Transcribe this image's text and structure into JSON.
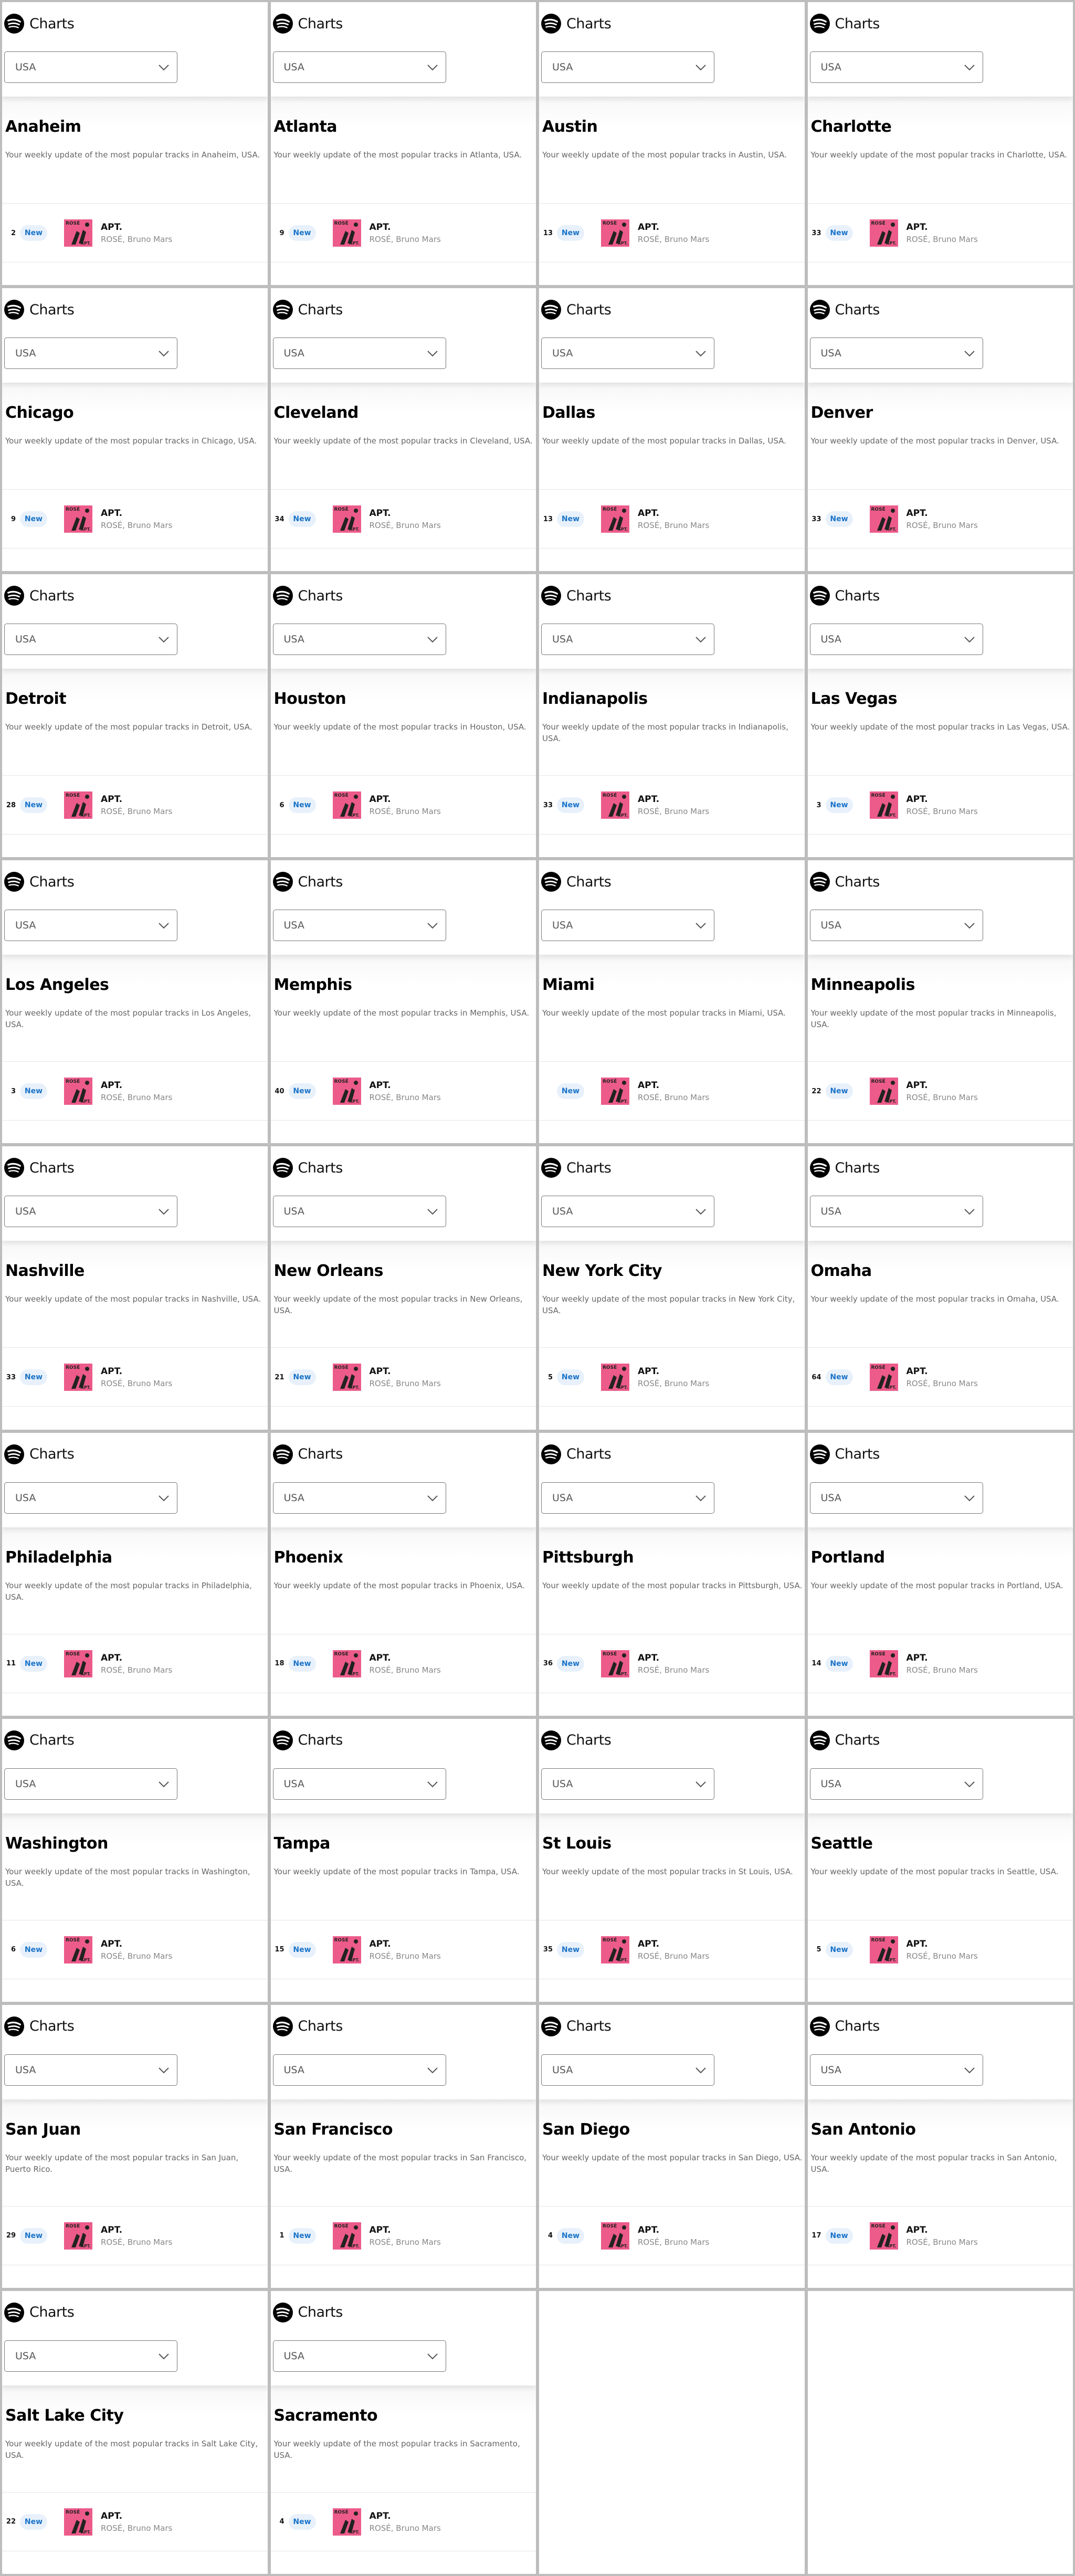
{
  "brand": {
    "label": "Charts",
    "logo_icon": "spotify-logo-icon"
  },
  "country_select": {
    "value": "USA"
  },
  "track": {
    "title": "APT.",
    "artists": "ROSÉ, Bruno Mars",
    "badge": "New",
    "art_color": "#ec5b8a",
    "art_text_top": "ROSÉ",
    "art_text_bottom": "APT."
  },
  "colors": {
    "badge_bg": "#e8f1fb",
    "badge_text": "#1a73c8"
  },
  "cities": [
    {
      "name": "Anaheim",
      "description": "Your weekly update of the most popular tracks in Anaheim, USA.",
      "rank": "2"
    },
    {
      "name": "Atlanta",
      "description": "Your weekly update of the most popular tracks in Atlanta, USA.",
      "rank": "9"
    },
    {
      "name": "Austin",
      "description": "Your weekly update of the most popular tracks in Austin, USA.",
      "rank": "13"
    },
    {
      "name": "Charlotte",
      "description": "Your weekly update of the most popular tracks in Charlotte, USA.",
      "rank": "33"
    },
    {
      "name": "Chicago",
      "description": "Your weekly update of the most popular tracks in Chicago, USA.",
      "rank": "9"
    },
    {
      "name": "Cleveland",
      "description": "Your weekly update of the most popular tracks in Cleveland, USA.",
      "rank": "34"
    },
    {
      "name": "Dallas",
      "description": "Your weekly update of the most popular tracks in Dallas, USA.",
      "rank": "13"
    },
    {
      "name": "Denver",
      "description": "Your weekly update of the most popular tracks in Denver, USA.",
      "rank": "33"
    },
    {
      "name": "Detroit",
      "description": "Your weekly update of the most popular tracks in Detroit, USA.",
      "rank": "28"
    },
    {
      "name": "Houston",
      "description": "Your weekly update of the most popular tracks in Houston, USA.",
      "rank": "6"
    },
    {
      "name": "Indianapolis",
      "description": "Your weekly update of the most popular tracks in Indianapolis, USA.",
      "rank": "33"
    },
    {
      "name": "Las Vegas",
      "description": "Your weekly update of the most popular tracks in Las Vegas, USA.",
      "rank": "3"
    },
    {
      "name": "Los Angeles",
      "description": "Your weekly update of the most popular tracks in Los Angeles, USA.",
      "rank": "3"
    },
    {
      "name": "Memphis",
      "description": "Your weekly update of the most popular tracks in Memphis, USA.",
      "rank": "40"
    },
    {
      "name": "Miami",
      "description": "Your weekly update of the most popular tracks in Miami, USA.",
      "rank": ""
    },
    {
      "name": "Minneapolis",
      "description": "Your weekly update of the most popular tracks in Minneapolis, USA.",
      "rank": "22"
    },
    {
      "name": "Nashville",
      "description": "Your weekly update of the most popular tracks in Nashville, USA.",
      "rank": "33"
    },
    {
      "name": "New Orleans",
      "description": "Your weekly update of the most popular tracks in New Orleans, USA.",
      "rank": "21"
    },
    {
      "name": "New York City",
      "description": "Your weekly update of the most popular tracks in New York City, USA.",
      "rank": "5"
    },
    {
      "name": "Omaha",
      "description": "Your weekly update of the most popular tracks in Omaha, USA.",
      "rank": "64"
    },
    {
      "name": "Philadelphia",
      "description": "Your weekly update of the most popular tracks in Philadelphia, USA.",
      "rank": "11"
    },
    {
      "name": "Phoenix",
      "description": "Your weekly update of the most popular tracks in Phoenix, USA.",
      "rank": "18"
    },
    {
      "name": "Pittsburgh",
      "description": "Your weekly update of the most popular tracks in Pittsburgh, USA.",
      "rank": "36"
    },
    {
      "name": "Portland",
      "description": "Your weekly update of the most popular tracks in Portland, USA.",
      "rank": "14"
    },
    {
      "name": "Washington",
      "description": "Your weekly update of the most popular tracks in Washington, USA.",
      "rank": "6"
    },
    {
      "name": "Tampa",
      "description": "Your weekly update of the most popular tracks in Tampa, USA.",
      "rank": "15"
    },
    {
      "name": "St Louis",
      "description": "Your weekly update of the most popular tracks in St Louis, USA.",
      "rank": "35"
    },
    {
      "name": "Seattle",
      "description": "Your weekly update of the most popular tracks in Seattle, USA.",
      "rank": "5"
    },
    {
      "name": "San Juan",
      "description": "Your weekly update of the most popular tracks in San Juan, Puerto Rico.",
      "rank": "29"
    },
    {
      "name": "San Francisco",
      "description": "Your weekly update of the most popular tracks in San Francisco, USA.",
      "rank": "1"
    },
    {
      "name": "San Diego",
      "description": "Your weekly update of the most popular tracks in San Diego, USA.",
      "rank": "4"
    },
    {
      "name": "San Antonio",
      "description": "Your weekly update of the most popular tracks in San Antonio, USA.",
      "rank": "17"
    },
    {
      "name": "Salt Lake City",
      "description": "Your weekly update of the most popular tracks in Salt Lake City, USA.",
      "rank": "22"
    },
    {
      "name": "Sacramento",
      "description": "Your weekly update of the most popular tracks in Sacramento, USA.",
      "rank": "4"
    }
  ]
}
